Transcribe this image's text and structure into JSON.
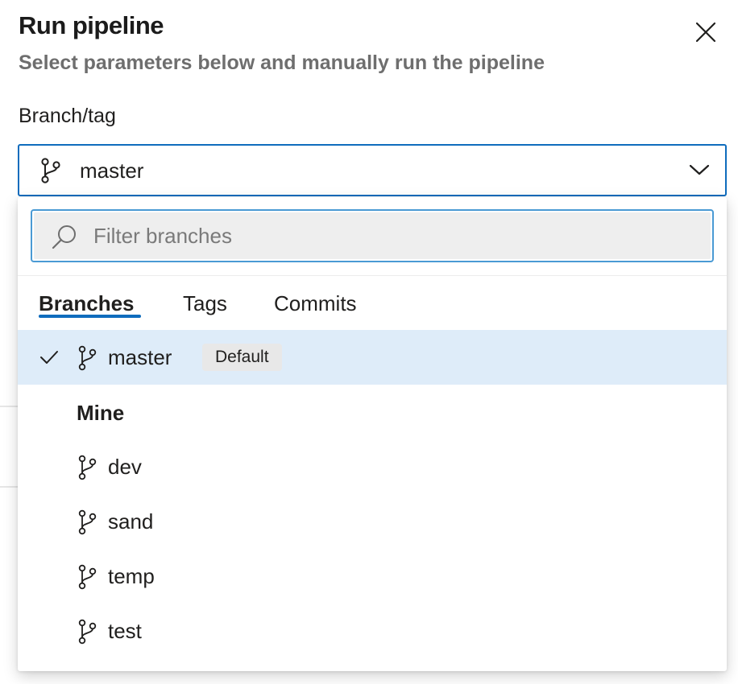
{
  "dialog": {
    "title": "Run pipeline",
    "subtitle": "Select parameters below and manually run the pipeline",
    "close_icon": "close-icon"
  },
  "branch_field": {
    "label": "Branch/tag",
    "value": "master",
    "icon": "git-branch-icon",
    "chevron": "chevron-down-icon"
  },
  "dropdown": {
    "filter": {
      "placeholder": "Filter branches",
      "value": "",
      "icon": "search-icon"
    },
    "tabs": [
      {
        "label": "Branches",
        "active": true
      },
      {
        "label": "Tags",
        "active": false
      },
      {
        "label": "Commits",
        "active": false
      }
    ],
    "selected_item": {
      "label": "master",
      "badge": "Default",
      "checked": true
    },
    "group_header": "Mine",
    "items": [
      {
        "label": "dev"
      },
      {
        "label": "sand"
      },
      {
        "label": "temp"
      },
      {
        "label": "test"
      }
    ]
  },
  "colors": {
    "accent": "#0f6cbd",
    "selected_row": "#deecf9",
    "filter_bg": "#eeeeee",
    "badge_bg": "#e8e8e8"
  }
}
